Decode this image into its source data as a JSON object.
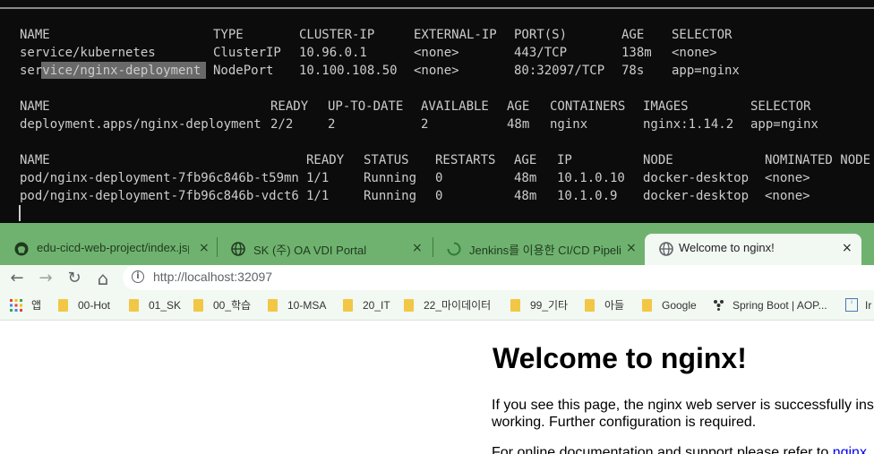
{
  "terminal": {
    "lines": [
      [
        "NAME",
        "TYPE",
        "CLUSTER-IP",
        "EXTERNAL-IP",
        "PORT(S)",
        "AGE",
        "SELECTOR"
      ],
      [
        "service/kubernetes",
        "ClusterIP",
        "10.96.0.1",
        "<none>",
        "443/TCP",
        "138m",
        "<none>"
      ],
      [
        "service/nginx-deployment",
        "NodePort",
        "10.100.108.50",
        "<none>",
        "80:32097/TCP",
        "78s",
        "app=nginx"
      ],
      [
        "NAME",
        "READY",
        "UP-TO-DATE",
        "AVAILABLE",
        "AGE",
        "CONTAINERS",
        "IMAGES",
        "SELECTOR"
      ],
      [
        "deployment.apps/nginx-deployment",
        "2/2",
        "2",
        "2",
        "48m",
        "nginx",
        "nginx:1.14.2",
        "app=nginx"
      ],
      [
        "NAME",
        "READY",
        "STATUS",
        "RESTARTS",
        "AGE",
        "IP",
        "NODE",
        "NOMINATED NODE"
      ],
      [
        "pod/nginx-deployment-7fb96c846b-t59mn",
        "1/1",
        "Running",
        "0",
        "48m",
        "10.1.0.10",
        "docker-desktop",
        "<none>"
      ],
      [
        "pod/nginx-deployment-7fb96c846b-vdct6",
        "1/1",
        "Running",
        "0",
        "48m",
        "10.1.0.9",
        "docker-desktop",
        "<none>"
      ]
    ]
  },
  "tabs": [
    {
      "title": "edu-cicd-web-project/index.jsp a",
      "icon": "github-icon",
      "close": "×"
    },
    {
      "title": "SK (주) OA VDI Portal",
      "icon": "globe-icon",
      "close": "×"
    },
    {
      "title": "Jenkins를 이용한 CI/CD Pipeline",
      "icon": "loading-icon",
      "close": "×"
    },
    {
      "title": "Welcome to nginx!",
      "icon": "globe-icon",
      "close": "×"
    }
  ],
  "toolbar": {
    "back": "←",
    "forward": "→",
    "reload": "↻",
    "home": "⌂",
    "url": "http://localhost:32097"
  },
  "bookmarks": [
    {
      "label": "앱",
      "icon": "apps-grid-icon"
    },
    {
      "label": "00-Hot",
      "icon": "folder-icon"
    },
    {
      "label": "01_SK",
      "icon": "folder-icon"
    },
    {
      "label": "00_학습",
      "icon": "folder-icon"
    },
    {
      "label": "10-MSA",
      "icon": "folder-icon"
    },
    {
      "label": "20_IT",
      "icon": "folder-icon"
    },
    {
      "label": "22_마이데이터",
      "icon": "folder-icon"
    },
    {
      "label": "99_기타",
      "icon": "folder-icon"
    },
    {
      "label": "아들",
      "icon": "folder-icon"
    },
    {
      "label": "Google",
      "icon": "folder-icon"
    },
    {
      "label": "Spring Boot | AOP...",
      "icon": "spring-dots-icon"
    },
    {
      "label": "Ir",
      "icon": "info-badge-icon"
    }
  ],
  "page": {
    "heading": "Welcome to nginx!",
    "para1_line1": "If you see this page, the nginx web server is successfully ins",
    "para1_line2": "working. Further configuration is required.",
    "para2_start": "For online documentation and support please refer to ",
    "para2_link": "nginx"
  },
  "colors": {
    "terminal_bg": "#0c0c0c",
    "terminal_text": "#cccccc",
    "tabstrip_bg": "#6fb26f",
    "toolbar_bg": "#f2f8f2",
    "link": "#0000ee"
  }
}
